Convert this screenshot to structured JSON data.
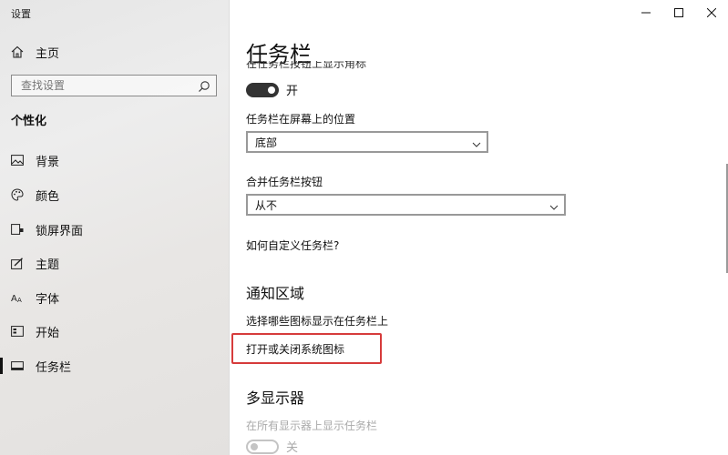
{
  "window": {
    "title": "设置",
    "controls": [
      "minimize",
      "maximize",
      "close"
    ]
  },
  "sidebar": {
    "home_label": "主页",
    "search_placeholder": "查找设置",
    "section_title": "个性化",
    "items": [
      {
        "label": "背景",
        "icon": "image-icon"
      },
      {
        "label": "颜色",
        "icon": "palette-icon"
      },
      {
        "label": "锁屏界面",
        "icon": "lockscreen-icon"
      },
      {
        "label": "主题",
        "icon": "theme-brush-icon"
      },
      {
        "label": "字体",
        "icon": "font-icon"
      },
      {
        "label": "开始",
        "icon": "start-icon"
      },
      {
        "label": "任务栏",
        "icon": "taskbar-icon",
        "active": true
      }
    ]
  },
  "main": {
    "title": "任务栏",
    "partial_label": "在任务栏按钮上显示角标",
    "badge_toggle": {
      "state": "on",
      "label": "开"
    },
    "position": {
      "label": "任务栏在屏幕上的位置",
      "value": "底部"
    },
    "combine": {
      "label": "合并任务栏按钮",
      "value": "从不"
    },
    "customize_link": "如何自定义任务栏?",
    "notification": {
      "heading": "通知区域",
      "select_icons_link": "选择哪些图标显示在任务栏上",
      "system_icons_link": "打开或关闭系统图标"
    },
    "multi_display": {
      "heading": "多显示器",
      "show_all_label": "在所有显示器上显示任务栏",
      "toggle": {
        "state": "off",
        "label": "关"
      }
    }
  },
  "colors": {
    "highlight_border": "#d63b3b",
    "toggle_on": "#333333"
  }
}
